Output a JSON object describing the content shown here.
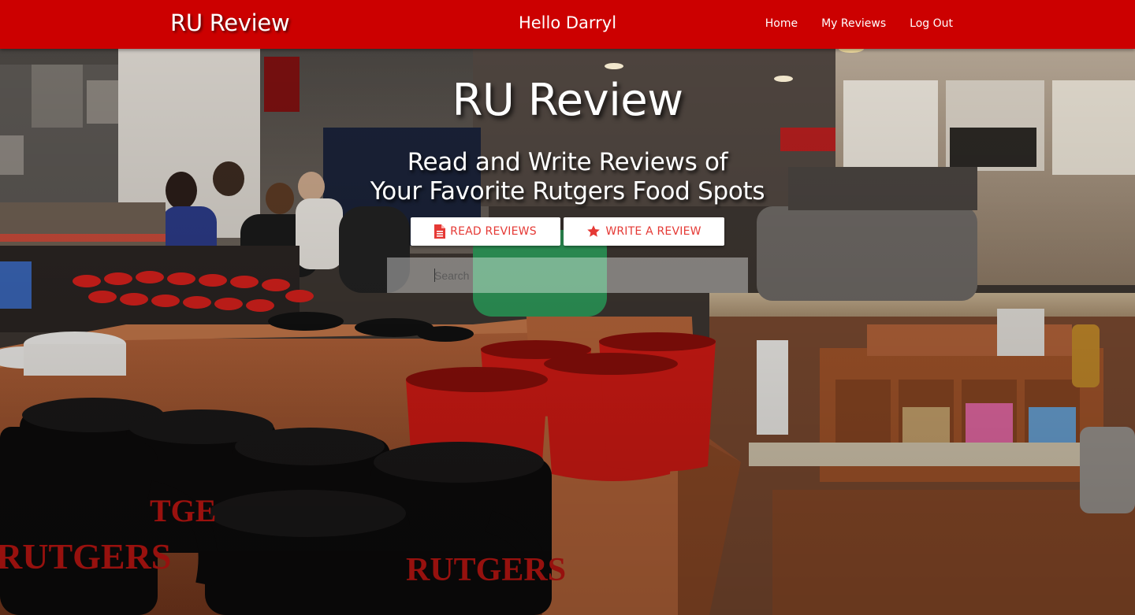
{
  "navbar": {
    "brand": "RU Review",
    "greeting": "Hello Darryl",
    "links": [
      {
        "label": "Home"
      },
      {
        "label": "My Reviews"
      },
      {
        "label": "Log Out"
      }
    ]
  },
  "hero": {
    "title": "RU Review",
    "subtitle_line1": "Read and Write Reviews of",
    "subtitle_line2": "Your Favorite Rutgers Food Spots",
    "read_button": {
      "label": "READ REVIEWS",
      "icon": "document-icon"
    },
    "write_button": {
      "label": "WRITE A REVIEW",
      "icon": "star-icon"
    },
    "search": {
      "placeholder": "Search",
      "value": ""
    },
    "background_image": "food-court-photo-with-rutgers-mugs"
  },
  "colors": {
    "primary": "#cc0000",
    "button_text": "#e53935",
    "button_bg": "#ffffff"
  }
}
